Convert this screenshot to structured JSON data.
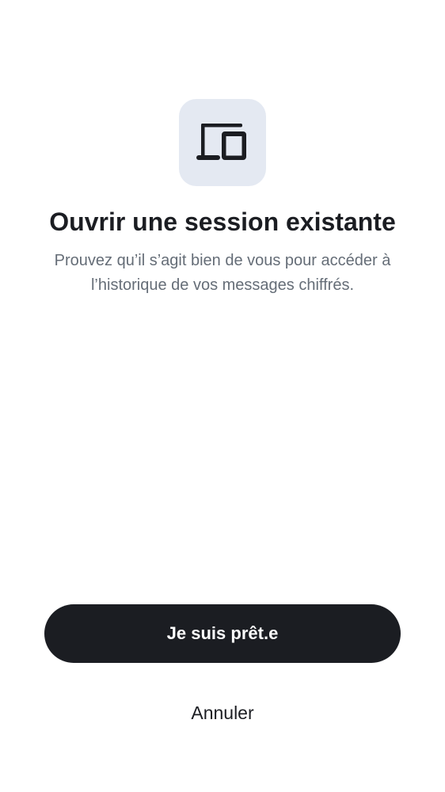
{
  "header": {
    "icon": "devices-icon",
    "icon_tile_color": "#e4e9f2",
    "title": "Ouvrir une session existante",
    "subtitle": "Prouvez qu’il s’agit bien de vous pour accéder à l’historique de vos messages chiffrés."
  },
  "actions": {
    "primary_label": "Je suis prêt.e",
    "primary_color": "#1b1d22",
    "cancel_label": "Annuler"
  }
}
